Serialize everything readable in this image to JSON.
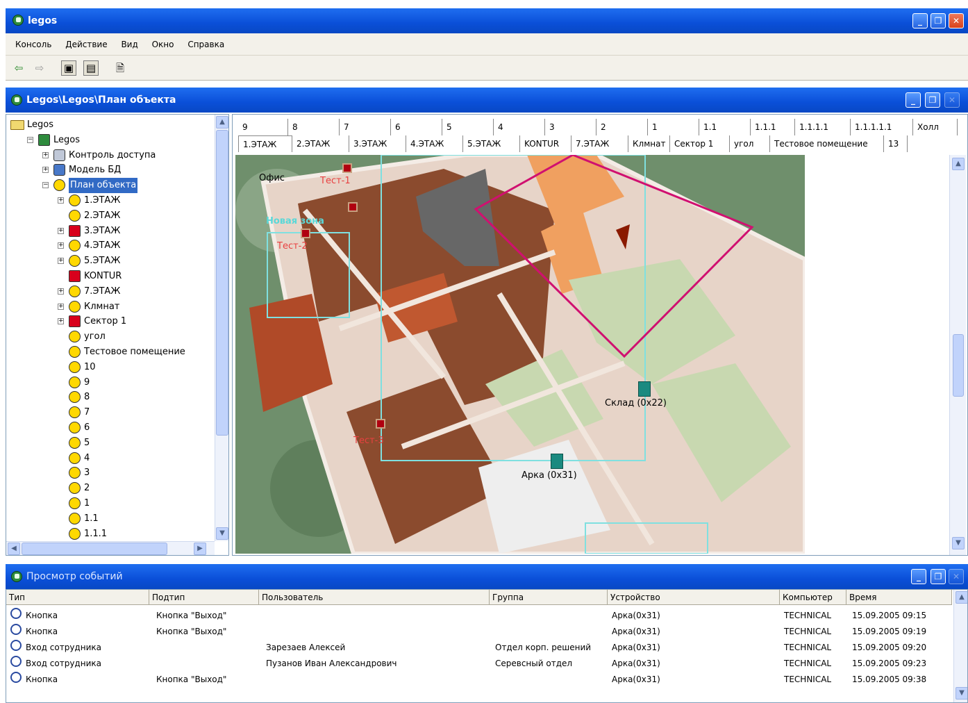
{
  "app": {
    "title": "legos",
    "menu": [
      "Консоль",
      "Действие",
      "Вид",
      "Окно",
      "Справка"
    ]
  },
  "plan_window": {
    "title": "Legos\\Legos\\План объекта",
    "tree": [
      {
        "label": "Legos",
        "icon": "folder-icon"
      },
      {
        "label": "Legos",
        "icon": "server-icon"
      },
      {
        "label": "Контроль доступа",
        "icon": "lock-icon"
      },
      {
        "label": "Модель БД",
        "icon": "database-icon"
      },
      {
        "label": "План объекта",
        "icon": "plan-icon",
        "selected": true
      },
      {
        "label": "1.ЭТАЖ"
      },
      {
        "label": "2.ЭТАЖ"
      },
      {
        "label": "3.ЭТАЖ"
      },
      {
        "label": "4.ЭТАЖ"
      },
      {
        "label": "5.ЭТАЖ"
      },
      {
        "label": "KONTUR"
      },
      {
        "label": "7.ЭТАЖ"
      },
      {
        "label": "Клмнат"
      },
      {
        "label": "Сектор 1"
      },
      {
        "label": "угол"
      },
      {
        "label": "Тестовое помещение"
      },
      {
        "label": "10"
      },
      {
        "label": "9"
      },
      {
        "label": "8"
      },
      {
        "label": "7"
      },
      {
        "label": "6"
      },
      {
        "label": "5"
      },
      {
        "label": "4"
      },
      {
        "label": "3"
      },
      {
        "label": "2"
      },
      {
        "label": "1"
      },
      {
        "label": "1.1"
      },
      {
        "label": "1.1.1"
      }
    ],
    "tabs_top": [
      "9",
      "8",
      "7",
      "6",
      "5",
      "4",
      "3",
      "2",
      "1",
      "1.1",
      "1.1.1",
      "1.1.1.1",
      "1.1.1.1.1",
      "Холл"
    ],
    "tabs_bottom": [
      "1.ЭТАЖ",
      "2.ЭТАЖ",
      "3.ЭТАЖ",
      "4.ЭТАЖ",
      "5.ЭТАЖ",
      "KONTUR",
      "7.ЭТАЖ",
      "Клмнат",
      "Сектор 1",
      "угол",
      "Тестовое помещение",
      "13"
    ],
    "map_labels": {
      "office": "Офис",
      "test1": "Тест-1",
      "new_zone": "Новая зона",
      "test2": "Тест-2",
      "test3": "Тест-3",
      "sklad": "Склад (0x22)",
      "arka": "Арка (0x31)"
    }
  },
  "events_window": {
    "title": "Просмотр событий",
    "columns": [
      "Тип",
      "Подтип",
      "Пользователь",
      "Группа",
      "Устройство",
      "Компьютер",
      "Время"
    ],
    "rows": [
      {
        "type": "Кнопка",
        "subtype": "Кнопка \"Выход\"",
        "user": "",
        "group": "",
        "device": "Арка(0x31)",
        "computer": "TECHNICAL",
        "time": "15.09.2005 09:15"
      },
      {
        "type": "Кнопка",
        "subtype": "Кнопка \"Выход\"",
        "user": "",
        "group": "",
        "device": "Арка(0x31)",
        "computer": "TECHNICAL",
        "time": "15.09.2005 09:19"
      },
      {
        "type": "Вход сотрудника",
        "subtype": "",
        "user": "Зарезаев Алексей",
        "group": "Отдел корп. решений",
        "device": "Арка(0x31)",
        "computer": "TECHNICAL",
        "time": "15.09.2005 09:20"
      },
      {
        "type": "Вход сотрудника",
        "subtype": "",
        "user": "Пузанов Иван Александрович",
        "group": "Серевсный отдел",
        "device": "Арка(0x31)",
        "computer": "TECHNICAL",
        "time": "15.09.2005 09:23"
      },
      {
        "type": "Кнопка",
        "subtype": "Кнопка \"Выход\"",
        "user": "",
        "group": "",
        "device": "Арка(0x31)",
        "computer": "TECHNICAL",
        "time": "15.09.2005 09:38"
      }
    ]
  }
}
